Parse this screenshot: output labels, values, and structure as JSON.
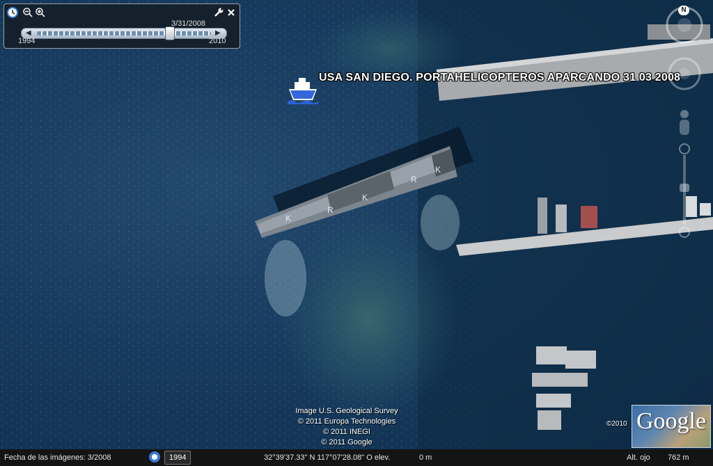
{
  "placemark": {
    "label": "USA SAN DIEGO. PORTAHELICOPTEROS APARCANDO 31 03 2008",
    "icon": "ship-icon"
  },
  "timebar": {
    "current_date": "3/31/2008",
    "start_year": "1994",
    "end_year": "2010",
    "position": 0.76,
    "icons": [
      "clock-icon",
      "zoom-out-icon",
      "zoom-in-icon",
      "wrench-icon",
      "close-icon"
    ]
  },
  "navigation": {
    "north_label": "N"
  },
  "credits": [
    "Image U.S. Geological Survey",
    "© 2011 Europa Technologies",
    "© 2011 INEGI",
    "© 2011 Google"
  ],
  "logo": {
    "text": "Google",
    "year": "©2010"
  },
  "status_bar": {
    "imagery_date": "Fecha de las imágenes: 3/2008",
    "historical_year": "1994",
    "coordinates": "32°39'37.33\" N 117°07'28.08\" O elev.",
    "elevation": "0 m",
    "eye_alt_label": "Alt. ojo",
    "eye_alt_value": "762 m"
  }
}
